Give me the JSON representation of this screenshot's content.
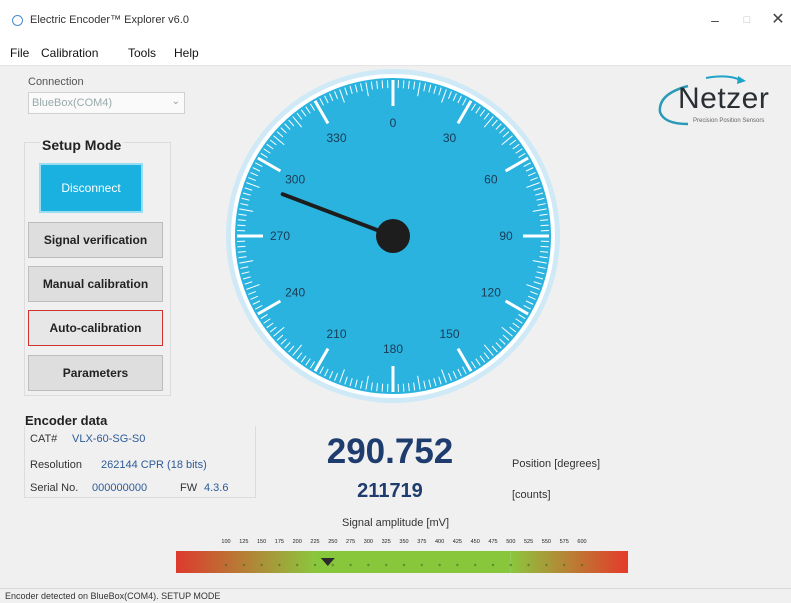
{
  "window": {
    "title": "Electric Encoder™ Explorer v6.0",
    "minimize": "–",
    "maximize": "□",
    "close": "✕"
  },
  "menu": [
    "File",
    "Calibration",
    "Tools",
    "Help"
  ],
  "connection": {
    "label": "Connection",
    "value": "BlueBox(COM4)",
    "arrow": "⌄"
  },
  "setup": {
    "title": "Setup Mode",
    "buttons": {
      "disconnect": "Disconnect",
      "signal_verification": "Signal verification",
      "manual_calibration": "Manual calibration",
      "auto_calibration": "Auto-calibration",
      "parameters": "Parameters"
    }
  },
  "logo": {
    "text": "Netzer",
    "tagline": "Precision Position Sensors"
  },
  "dial": {
    "labels": [
      "0",
      "30",
      "60",
      "90",
      "120",
      "150",
      "180",
      "210",
      "240",
      "270",
      "300",
      "330"
    ],
    "needle_degrees": 290.752,
    "face_color": "#2bb3df",
    "ring_color": "#cfeaf6"
  },
  "encoder": {
    "title": "Encoder data",
    "cat_label": "CAT#",
    "cat_value": "VLX-60-SG-S0",
    "resolution_label": "Resolution",
    "resolution_value": "262144 CPR (18 bits)",
    "serial_label": "Serial No.",
    "serial_value": "000000000",
    "fw_label": "FW",
    "fw_value": "4.3.6"
  },
  "readout": {
    "position": "290.752",
    "position_unit": "Position [degrees]",
    "counts": "211719",
    "counts_unit": "[counts]"
  },
  "amplitude": {
    "title": "Signal amplitude [mV]",
    "ticks": [
      "100",
      "125",
      "150",
      "175",
      "200",
      "225",
      "250",
      "275",
      "300",
      "325",
      "350",
      "375",
      "400",
      "425",
      "450",
      "475",
      "500",
      "525",
      "550",
      "575",
      "600"
    ],
    "marker_value": 250,
    "good_range": [
      225,
      500
    ],
    "colors": {
      "low": "#d9392e",
      "good": "#88c63c",
      "high": "#e53a2b"
    }
  },
  "status": "Encoder detected on BlueBox(COM4). SETUP MODE"
}
